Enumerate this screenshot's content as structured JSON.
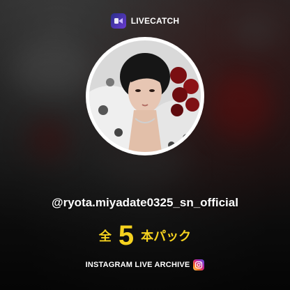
{
  "brand": {
    "name": "LIVECATCH",
    "logo_icon": "livecatch-logo-icon"
  },
  "profile": {
    "avatar_icon": "profile-photo",
    "handle": "@ryota.miyadate0325_sn_official"
  },
  "pack": {
    "prefix": "全",
    "count": "5",
    "suffix": "本パック"
  },
  "archive": {
    "label": "INSTAGRAM LIVE ARCHIVE",
    "icon": "instagram-icon"
  },
  "colors": {
    "accent_yellow": "#f5d21f",
    "text_white": "#ffffff",
    "avatar_ring": "#ffffff"
  }
}
